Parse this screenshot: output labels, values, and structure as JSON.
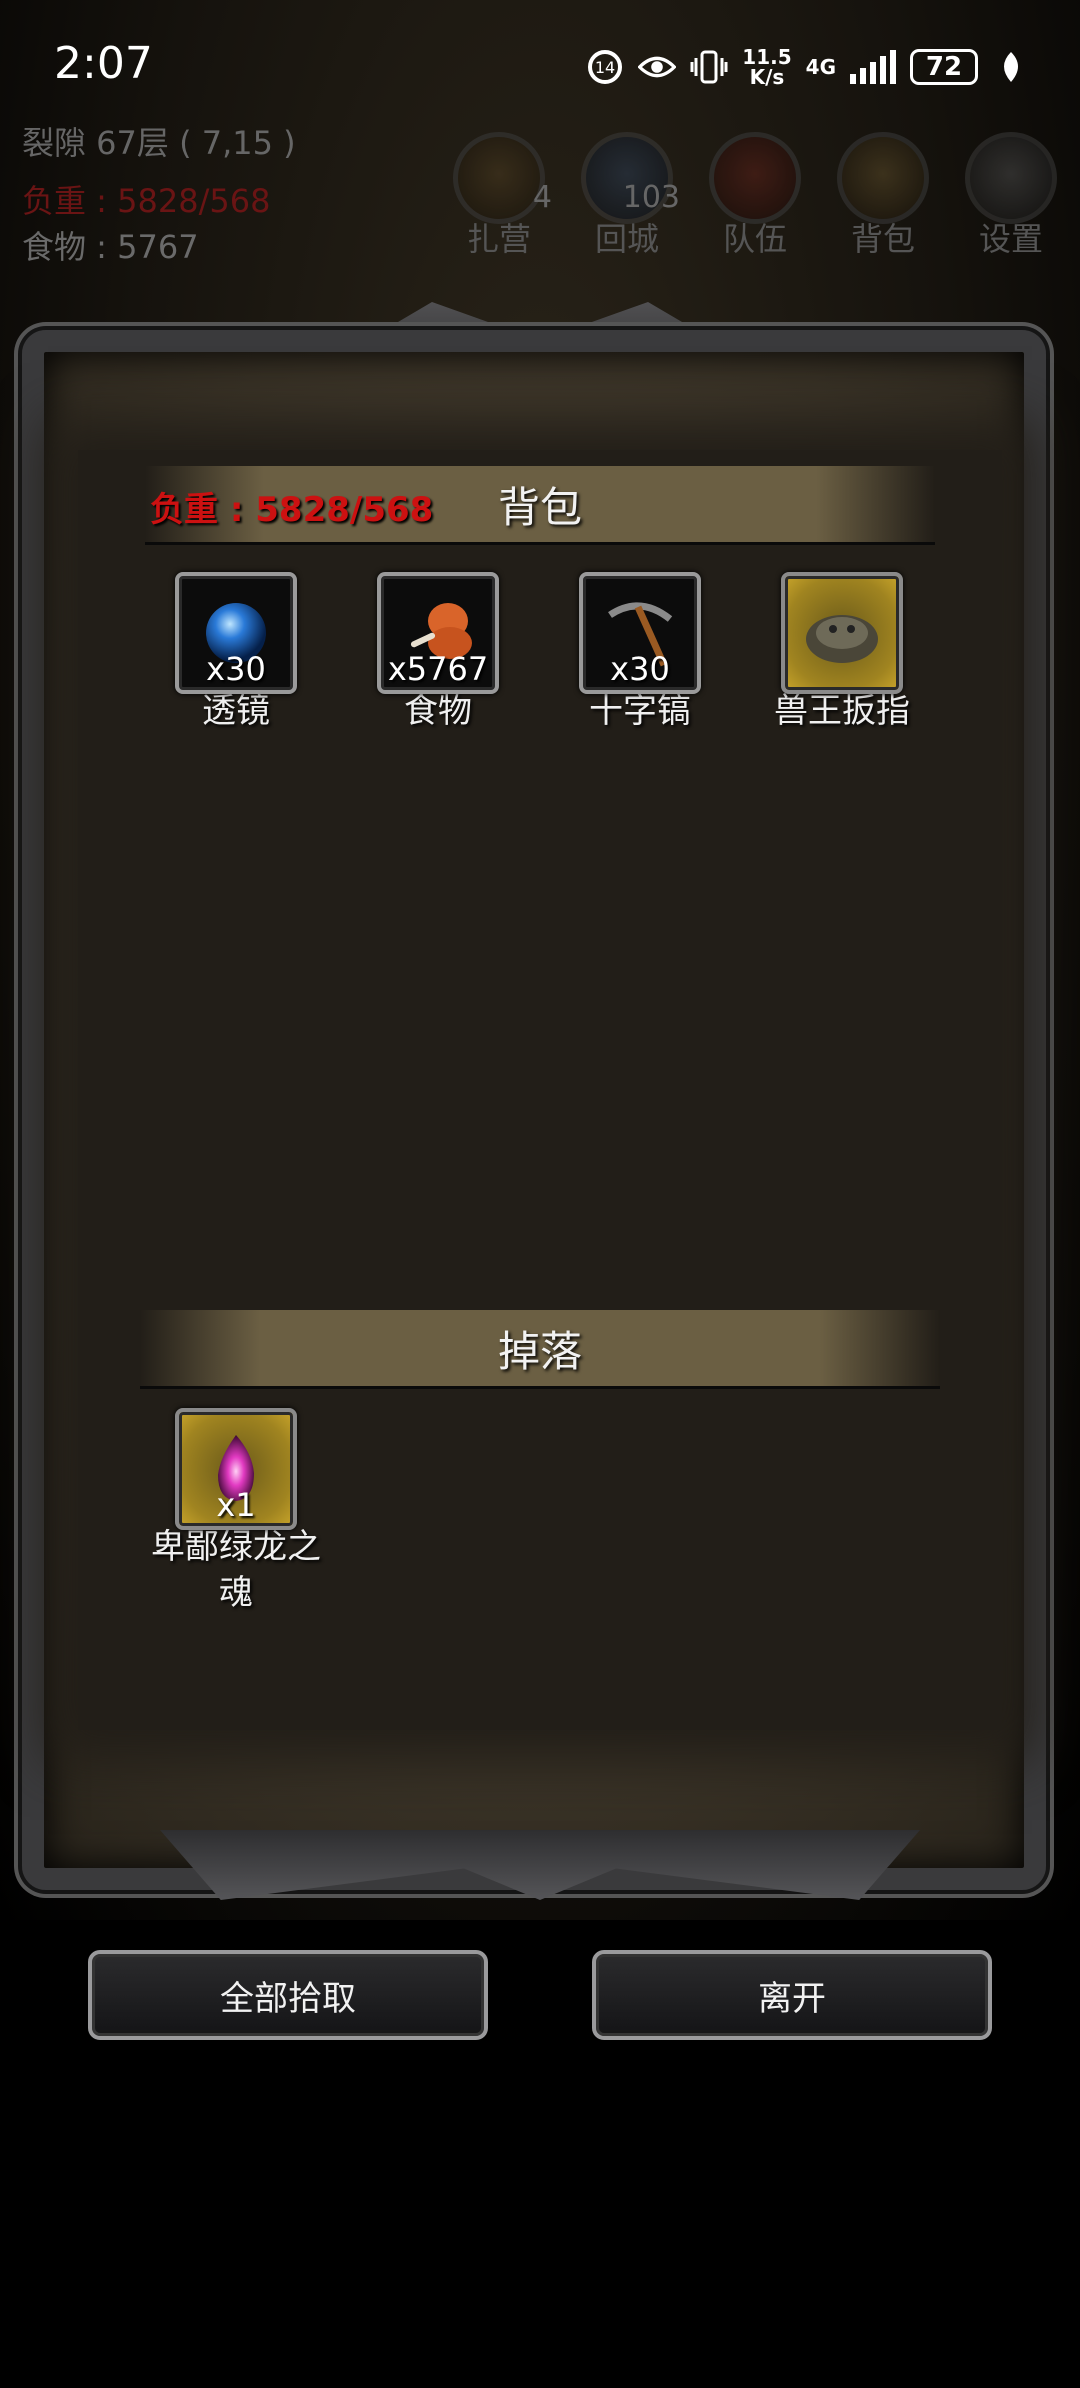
{
  "status_bar": {
    "time": "2:07",
    "net_speed_top": "11.5",
    "net_speed_bottom": "K/s",
    "network": "4G",
    "battery": "72"
  },
  "header": {
    "location": "裂隙 67层 ( 7,15 )",
    "weight": "负重 : 5828/568",
    "food": "食物 : 5767"
  },
  "nav": [
    {
      "label": "扎营",
      "badge": "4"
    },
    {
      "label": "回城",
      "badge": "103"
    },
    {
      "label": "队伍",
      "badge": ""
    },
    {
      "label": "背包",
      "badge": ""
    },
    {
      "label": "设置",
      "badge": ""
    }
  ],
  "backpack": {
    "title": "背包",
    "weight": "负重 : 5828/568",
    "items": [
      {
        "name": "透镜",
        "qty": "x30",
        "icon": "blue-orb-icon"
      },
      {
        "name": "食物",
        "qty": "x5767",
        "icon": "meat-drumstick-icon"
      },
      {
        "name": "十字镐",
        "qty": "x30",
        "icon": "pickaxe-icon"
      },
      {
        "name": "兽王扳指",
        "qty": "",
        "icon": "beast-ring-icon"
      }
    ]
  },
  "drops": {
    "title": "掉落",
    "items": [
      {
        "name": "卑鄙绿龙之魂",
        "qty": "x1",
        "icon": "dragon-soul-icon"
      }
    ]
  },
  "buttons": {
    "pickup_all": "全部拾取",
    "leave": "离开"
  },
  "colors": {
    "weight_red": "#cc1111",
    "header_bar": "#6b5f43",
    "gold_slot": "#c9a52b"
  }
}
